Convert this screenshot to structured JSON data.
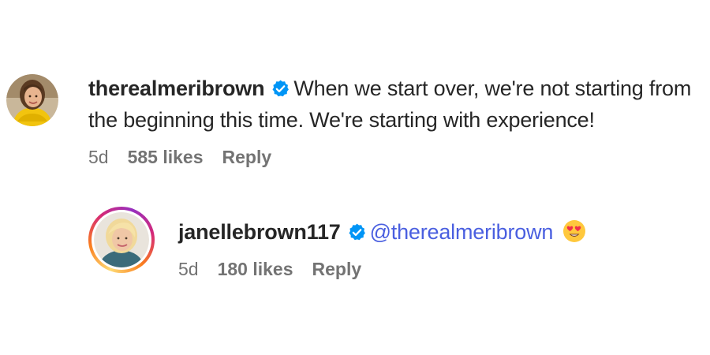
{
  "comments": [
    {
      "username": "therealmeribrown",
      "verified": true,
      "text": "When we start over, we're not starting from the beginning this time. We're starting with experience!",
      "age": "5d",
      "likes": "585 likes",
      "reply_label": "Reply"
    },
    {
      "username": "janellebrown117",
      "verified": true,
      "mention": "@therealmeribrown",
      "emoji": "heart-eyes-emoji",
      "age": "5d",
      "likes": "180 likes",
      "reply_label": "Reply"
    }
  ],
  "colors": {
    "text": "#262626",
    "meta": "#737373",
    "mention": "#4a5fe0",
    "verified": "#0095f6"
  }
}
